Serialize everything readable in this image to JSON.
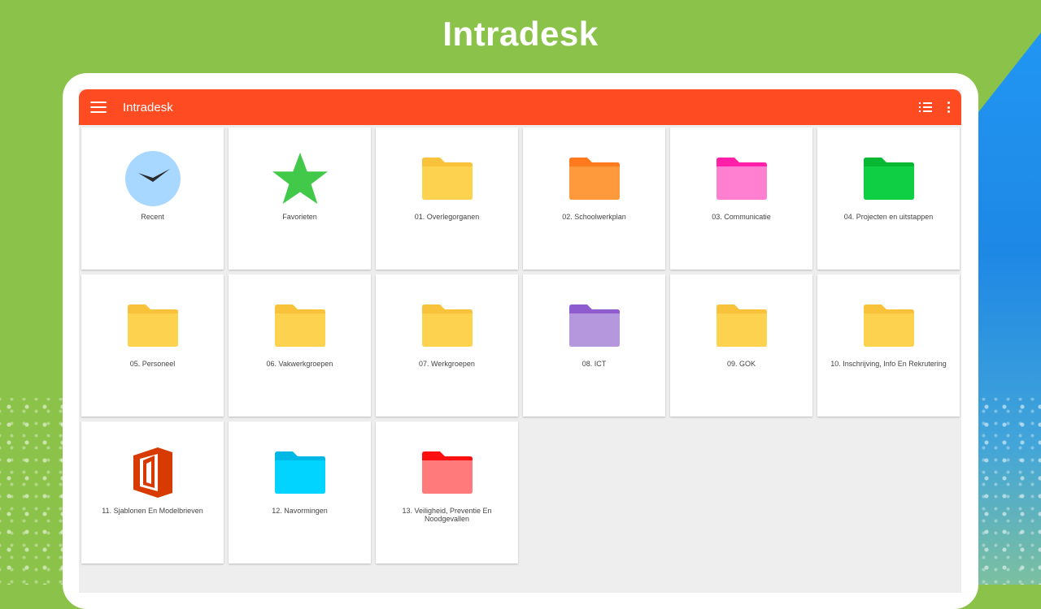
{
  "hero": {
    "title": "Intradesk"
  },
  "appbar": {
    "title": "Intradesk",
    "menu_icon": "hamburger-menu-icon",
    "list_icon": "list-view-icon",
    "more_icon": "more-vertical-icon",
    "color": "#ff4b22"
  },
  "tiles": [
    {
      "label": "Recent",
      "icon": "clock-icon",
      "color": "#a8d8ff"
    },
    {
      "label": "Favorieten",
      "icon": "star-icon",
      "color": "#43c94a"
    },
    {
      "label": "01. Overlegorganen",
      "icon": "folder-icon",
      "color": "#fdd24e",
      "tab": "#f8c23a"
    },
    {
      "label": "02. Schoolwerkplan",
      "icon": "folder-icon",
      "color": "#ff9a3c",
      "tab": "#ff7a1f"
    },
    {
      "label": "03. Communicatie",
      "icon": "folder-icon",
      "color": "#ff7fd0",
      "tab": "#ff1fa8"
    },
    {
      "label": "04. Projecten en uitstappen",
      "icon": "folder-icon",
      "color": "#0fcf44",
      "tab": "#08b832"
    },
    {
      "label": "05. Personeel",
      "icon": "folder-icon",
      "color": "#fdd24e",
      "tab": "#f8c23a"
    },
    {
      "label": "06. Vakwerkgroepen",
      "icon": "folder-icon",
      "color": "#fdd24e",
      "tab": "#f8c23a"
    },
    {
      "label": "07. Werkgroepen",
      "icon": "folder-icon",
      "color": "#fdd24e",
      "tab": "#f8c23a"
    },
    {
      "label": "08. ICT",
      "icon": "folder-icon",
      "color": "#b597dd",
      "tab": "#8f5ccf"
    },
    {
      "label": "09. GOK",
      "icon": "folder-icon",
      "color": "#fdd24e",
      "tab": "#f8c23a"
    },
    {
      "label": "10. Inschrijving, Info En Rekrutering",
      "icon": "folder-icon",
      "color": "#fdd24e",
      "tab": "#f8c23a"
    },
    {
      "label": "11. Sjablonen En Modelbrieven",
      "icon": "office-icon",
      "color": "#d83b01"
    },
    {
      "label": "12. Navormingen",
      "icon": "folder-icon",
      "color": "#00d4ff",
      "tab": "#00b8e6"
    },
    {
      "label": "13. Veiligheid, Preventie En Noodgevallen",
      "icon": "folder-icon",
      "color": "#ff7b7b",
      "tab": "#ff1010"
    }
  ]
}
